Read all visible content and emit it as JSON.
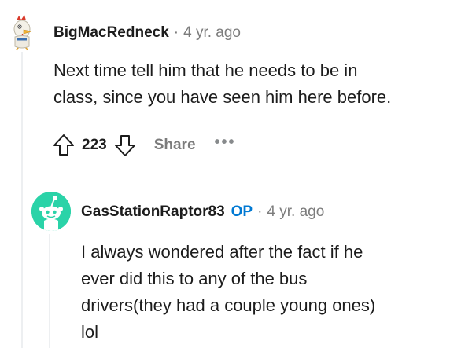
{
  "comments": [
    {
      "author": "BigMacRedneck",
      "separator": "·",
      "age": "4 yr. ago",
      "avatar_icon": "rooster-avatar-icon",
      "body_lines": [
        "Next time tell him that he needs to be in",
        "class, since you have seen him here before."
      ],
      "score": "223",
      "share_label": "Share",
      "more_label": "•••"
    },
    {
      "author": "GasStationRaptor83",
      "op_badge": "OP",
      "separator": "·",
      "age": "4 yr. ago",
      "avatar_icon": "snoo-avatar-icon",
      "body_lines": [
        "I always wondered after the fact if he",
        "ever did this to any of the bus",
        "drivers(they had a couple young ones)",
        "lol"
      ]
    }
  ],
  "colors": {
    "op_badge": "#0079d3",
    "meta_gray": "#7c7c7c",
    "thread_line": "#edeff1",
    "snoo_background": "#2ad3a8"
  }
}
